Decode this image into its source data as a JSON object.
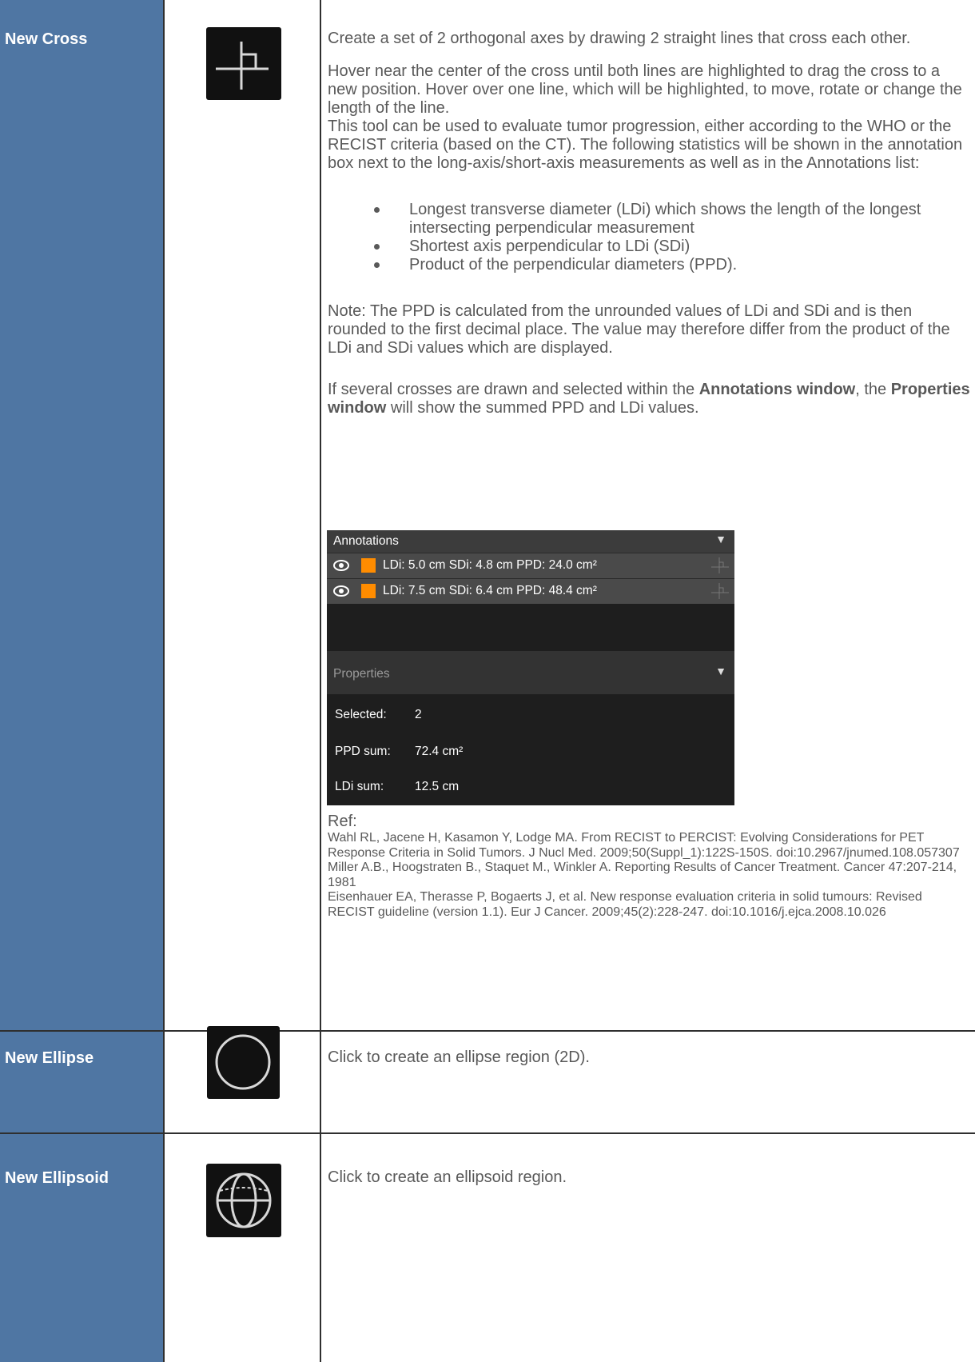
{
  "rows": [
    {
      "name": "New Cross",
      "icon": "cross-tool-icon",
      "paragraphs": [
        "Create a set of 2 orthogonal axes by drawing 2 straight lines that cross each other.",
        "Hover near the center of the cross until both lines are highlighted to drag the cross to a new position. Hover over one line, which will be highlighted, to move, rotate or change the length of the line.",
        "This tool can be used to evaluate tumor progression, either according to the WHO or the RECIST criteria (based on the CT). The following statistics will be shown in the annotation box next to the long-axis/short-axis measurements as well as in the Annotations list:"
      ],
      "bullets": [
        "Longest transverse diameter (LDi) which shows the length of the longest intersecting perpendicular measurement",
        "Shortest axis perpendicular to LDi (SDi)",
        "Product of the perpendicular diameters (PPD)."
      ],
      "note": "Note: The PPD is calculated from the unrounded values of LDi and SDi and is then rounded to the first decimal place. The value may therefore differ from the product of the LDi and SDi values which are displayed.",
      "several": {
        "pre": "If several crosses are drawn and selected within the ",
        "b1": "Annotations window",
        "mid": ", the ",
        "b2": "Properties window",
        "post": " will show the summed PPD and LDi values."
      },
      "panel": {
        "annotations_title": "Annotations",
        "annotations": [
          {
            "text": "LDi: 5.0 cm SDi: 4.8 cm PPD: 24.0 cm²",
            "color": "#ff8c00"
          },
          {
            "text": "LDi: 7.5 cm SDi: 6.4 cm PPD: 48.4 cm²",
            "color": "#ff8c00"
          }
        ],
        "properties_title": "Properties",
        "properties": [
          {
            "key": "Selected:",
            "value": "2"
          },
          {
            "key": "PPD sum:",
            "value": "72.4 cm²"
          },
          {
            "key": "LDi sum:",
            "value": "12.5 cm"
          }
        ]
      },
      "ref_label": "Ref:",
      "refs": [
        "Wahl RL, Jacene H, Kasamon Y, Lodge MA. From RECIST to PERCIST: Evolving Considerations for PET Response Criteria in Solid Tumors. J Nucl Med. 2009;50(Suppl_1):122S-150S. doi:10.2967/jnumed.108.057307",
        "Miller A.B., Hoogstraten B., Staquet M., Winkler A. Reporting Results of Cancer Treatment. Cancer 47:207-214, 1981",
        "Eisenhauer EA, Therasse P, Bogaerts J, et al. New response evaluation criteria in solid tumours: Revised RECIST guideline (version 1.1). Eur J Cancer. 2009;45(2):228-247. doi:10.1016/j.ejca.2008.10.026"
      ]
    },
    {
      "name": "New Ellipse",
      "icon": "ellipse-tool-icon",
      "description": "Click to create an ellipse region (2D)."
    },
    {
      "name": "New Ellipsoid",
      "icon": "ellipsoid-tool-icon",
      "description": "Click to create an ellipsoid region."
    }
  ],
  "colors": {
    "name_cell": "#4f76a3",
    "panel_bg": "#1e1e1e",
    "swatch": "#ff8c00"
  }
}
